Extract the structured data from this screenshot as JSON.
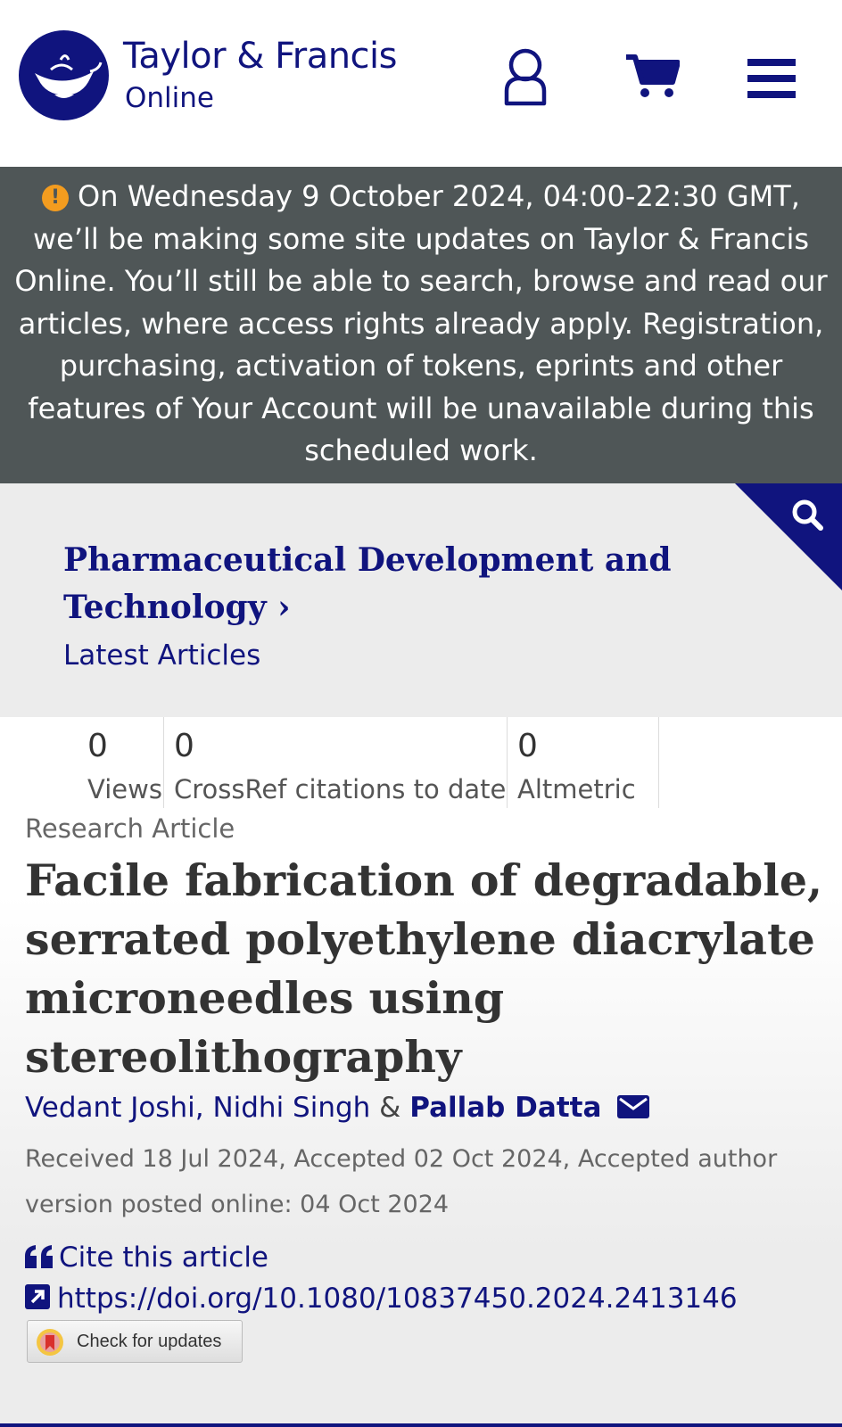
{
  "header": {
    "logo_main": "Taylor & Francis",
    "logo_sub": "Online",
    "icons": [
      "user-icon",
      "cart-icon",
      "menu-icon"
    ]
  },
  "banner": {
    "icon": "exclamation-icon",
    "text": "On Wednesday 9 October 2024, 04:00-22:30 GMT, we’ll be making some site updates on Taylor & Francis Online. You’ll still be able to search, browse and read our articles, where access rights already apply. Registration, purchasing, activation of tokens, eprints and other features of Your Account will be unavailable during this scheduled work."
  },
  "journal": {
    "title": "Pharmaceutical Development and Technology",
    "chevron": "›",
    "latest": "Latest Articles"
  },
  "metrics": [
    {
      "value": "0",
      "label": "Views"
    },
    {
      "value": "0",
      "label": "CrossRef citations to date"
    },
    {
      "value": "0",
      "label": "Altmetric"
    }
  ],
  "article": {
    "type": "Research Article",
    "title": "Facile fabrication of degradable, serrated polyethylene diacrylate microneedles using stereolithography",
    "authors": [
      {
        "name": "Vedant Joshi",
        "sep": ", "
      },
      {
        "name": "Nidhi Singh",
        "sep": " & "
      },
      {
        "name": "Pallab Datta",
        "sep": ""
      }
    ],
    "dates": "Received 18 Jul 2024, Accepted 02 Oct 2024, Accepted author version posted online: 04 Oct 2024",
    "cite": "Cite this article",
    "doi": "https://doi.org/10.1080/10837450.2024.2413146",
    "check_updates": "Check for updates"
  },
  "colors": {
    "brand": "#10147e",
    "banner_bg": "#4f5657",
    "warning": "#f39c1f"
  }
}
